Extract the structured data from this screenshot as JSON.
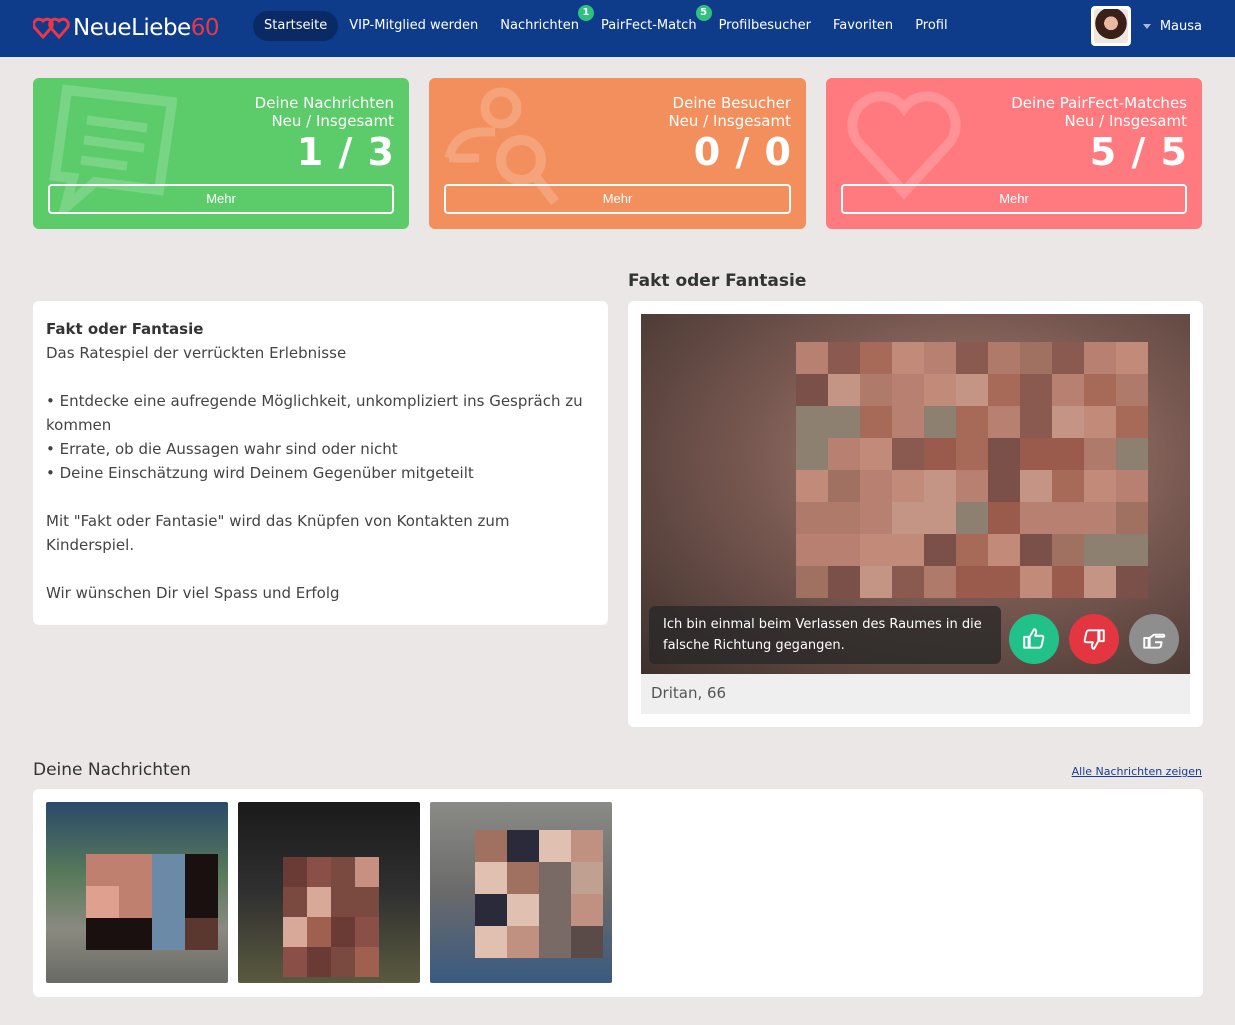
{
  "header": {
    "logo_text": "NeueLiebe",
    "logo_number": "60",
    "nav": [
      {
        "label": "Startseite",
        "active": true,
        "badge": ""
      },
      {
        "label": "VIP-Mitglied werden",
        "active": false,
        "badge": ""
      },
      {
        "label": "Nachrichten",
        "active": false,
        "badge": "1"
      },
      {
        "label": "PairFect-Match",
        "active": false,
        "badge": "5"
      },
      {
        "label": "Profilbesucher",
        "active": false,
        "badge": ""
      },
      {
        "label": "Favoriten",
        "active": false,
        "badge": ""
      },
      {
        "label": "Profil",
        "active": false,
        "badge": ""
      }
    ],
    "username": "Mausa"
  },
  "stats": {
    "messages": {
      "title": "Deine Nachrichten",
      "subtitle": "Neu / Insgesamt",
      "value": "1 / 3",
      "button": "Mehr",
      "color": "#5ccc6b"
    },
    "visitors": {
      "title": "Deine Besucher",
      "subtitle": "Neu / Insgesamt",
      "value": "0 / 0",
      "button": "Mehr",
      "color": "#f28f5d"
    },
    "matches": {
      "title": "Deine PairFect-Matches",
      "subtitle": "Neu / Insgesamt",
      "value": "5 / 5",
      "button": "Mehr",
      "color": "#ff7a7f"
    }
  },
  "fakt": {
    "section_title": "Fakt oder Fantasie",
    "info_title": "Fakt oder Fantasie",
    "info_subtitle": "Das Ratespiel der verrückten Erlebnisse",
    "bullets": [
      "• Entdecke eine aufregende Möglichkeit, unkompliziert ins Gespräch zu kommen",
      "• Errate, ob die Aussagen wahr sind oder nicht",
      "• Deine Einschätzung wird Deinem Gegenüber mitgeteilt"
    ],
    "paragraph": "Mit \"Fakt oder Fantasie\" wird das Knüpfen von Kontakten zum Kinderspiel.",
    "closing": "Wir wünschen Dir viel Spass und Erfolg",
    "statement": "Ich bin einmal beim Verlassen des Raumes in die falsche Richtung gegangen.",
    "person": "Dritan, 66",
    "vote_colors": {
      "fakt": "#23c18a",
      "fantasie": "#e33640",
      "skip": "#8e8e8e"
    }
  },
  "messages": {
    "title": "Deine Nachrichten",
    "link": "Alle Nachrichten zeigen"
  }
}
